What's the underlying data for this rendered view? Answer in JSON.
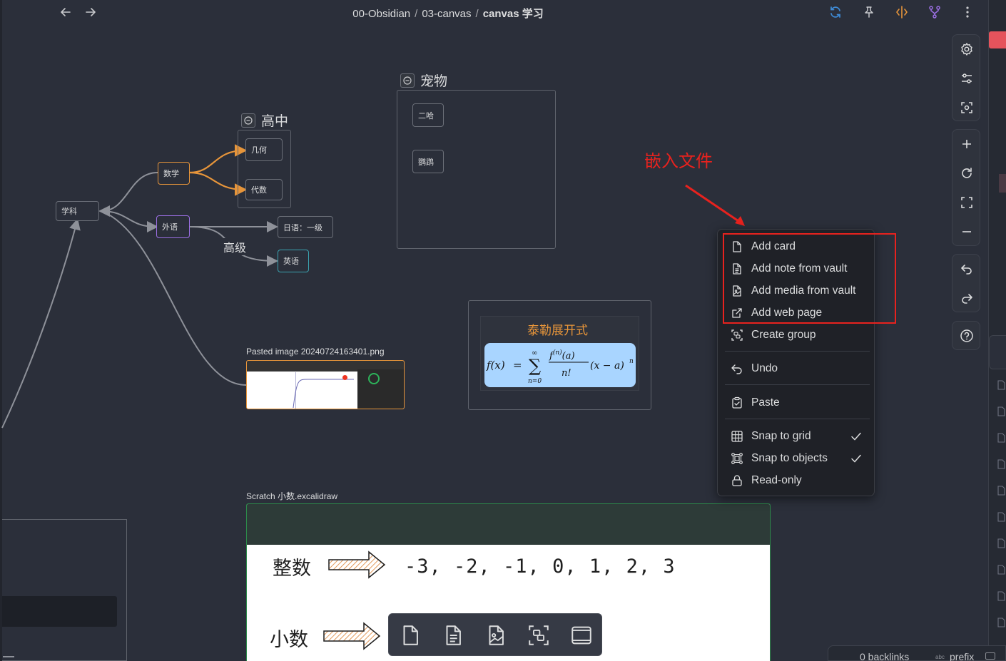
{
  "header": {
    "breadcrumb": [
      "00-Obsidian",
      "03-canvas",
      "canvas 学习"
    ],
    "separator": "/"
  },
  "icons": {
    "back": "arrow-left-icon",
    "forward": "arrow-right-icon",
    "sync": "sync-icon",
    "pin": "pin-icon",
    "split": "split-icon",
    "graph": "git-branch-icon",
    "more": "more-vertical-icon"
  },
  "colors": {
    "accent_orange": "#e7953a",
    "accent_purple": "#9b6fe3",
    "sync_blue": "#3e8bd6",
    "annotation_red": "#e8221e",
    "green_border": "#2c8a4a"
  },
  "canvas": {
    "groups": {
      "pets": "宠物",
      "highschool": "高中"
    },
    "nodes": {
      "xueke": "学科",
      "shuxue": "数学",
      "waiyu": "外语",
      "jihe": "几何",
      "daishu": "代数",
      "riyu": "日语：一级",
      "yingyu": "英语",
      "erha": "二哈",
      "pengqian": "鹦鹉"
    },
    "edge_label": "高级",
    "image_file": "Pasted image 20240724163401.png",
    "taylor_title": "泰勒展开式",
    "scratch_file": "Scratch 小数.excalidraw",
    "excalidraw": {
      "row1_label": "整数",
      "row1_values": "-3, -2, -1, 0, 1, 2, 3",
      "row2_label": "小数"
    }
  },
  "annotation": "嵌入文件",
  "context_menu": {
    "items": [
      {
        "label": "Add card",
        "icon": "file-icon"
      },
      {
        "label": "Add note from vault",
        "icon": "file-text-icon"
      },
      {
        "label": "Add media from vault",
        "icon": "file-image-icon"
      },
      {
        "label": "Add web page",
        "icon": "external-link-icon"
      },
      {
        "label": "Create group",
        "icon": "group-icon"
      },
      {
        "label": "Undo",
        "icon": "undo-icon"
      },
      {
        "label": "Paste",
        "icon": "clipboard-icon"
      },
      {
        "label": "Snap to grid",
        "icon": "grid-icon",
        "checked": true
      },
      {
        "label": "Snap to objects",
        "icon": "snap-objects-icon",
        "checked": true
      },
      {
        "label": "Read-only",
        "icon": "lock-icon"
      }
    ]
  },
  "status_bar": {
    "backlinks": "0 backlinks",
    "prefix": "prefix"
  }
}
